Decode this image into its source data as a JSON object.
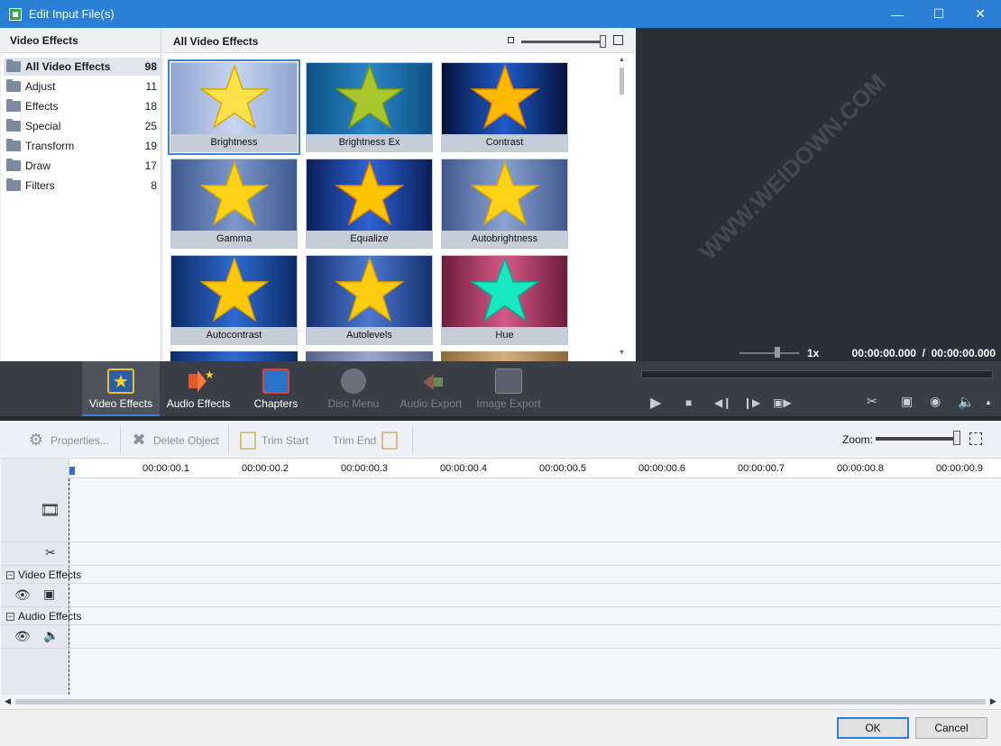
{
  "window": {
    "title": "Edit Input File(s)"
  },
  "categories": {
    "header": "Video Effects",
    "items": [
      {
        "name": "All Video Effects",
        "count": "98"
      },
      {
        "name": "Adjust",
        "count": "11"
      },
      {
        "name": "Effects",
        "count": "18"
      },
      {
        "name": "Special",
        "count": "25"
      },
      {
        "name": "Transform",
        "count": "19"
      },
      {
        "name": "Draw",
        "count": "17"
      },
      {
        "name": "Filters",
        "count": "8"
      }
    ]
  },
  "effects_grid": {
    "header": "All Video Effects",
    "tiles": [
      {
        "label": "Brightness"
      },
      {
        "label": "Brightness Ex"
      },
      {
        "label": "Contrast"
      },
      {
        "label": "Gamma"
      },
      {
        "label": "Equalize"
      },
      {
        "label": "Autobrightness"
      },
      {
        "label": "Autocontrast"
      },
      {
        "label": "Autolevels"
      },
      {
        "label": "Hue"
      }
    ]
  },
  "preview": {
    "speed": "1x",
    "time": "00:00:00.000  /  00:00:00.000"
  },
  "main_toolbar": {
    "tabs": [
      {
        "label": "Video Effects",
        "icon": "video-effects-icon"
      },
      {
        "label": "Audio Effects",
        "icon": "audio-effects-icon"
      },
      {
        "label": "Chapters",
        "icon": "chapters-icon"
      },
      {
        "label": "Disc Menu",
        "icon": "disc-menu-icon"
      },
      {
        "label": "Audio Export",
        "icon": "audio-export-icon"
      },
      {
        "label": "Image Export",
        "icon": "image-export-icon"
      }
    ]
  },
  "action_toolbar": {
    "properties": "Properties...",
    "delete": "Delete Object",
    "trim_start": "Trim Start",
    "trim_end": "Trim End",
    "zoom_label": "Zoom:"
  },
  "timeline": {
    "ruler": [
      "00:00:00.1",
      "00:00:00.2",
      "00:00:00.3",
      "00:00:00.4",
      "00:00:00.5",
      "00:00:00.6",
      "00:00:00.7",
      "00:00:00.8",
      "00:00:00.9"
    ],
    "video_effects_label": "Video Effects",
    "audio_effects_label": "Audio Effects"
  },
  "footer": {
    "ok": "OK",
    "cancel": "Cancel"
  },
  "watermark": "WWW.WEIDOWN.COM",
  "colors": {
    "accent": "#2b7fd4",
    "title_bar": "#2b7fd4",
    "dark_toolbar": "#3a3e47",
    "preview_bg": "#2c2f35"
  }
}
